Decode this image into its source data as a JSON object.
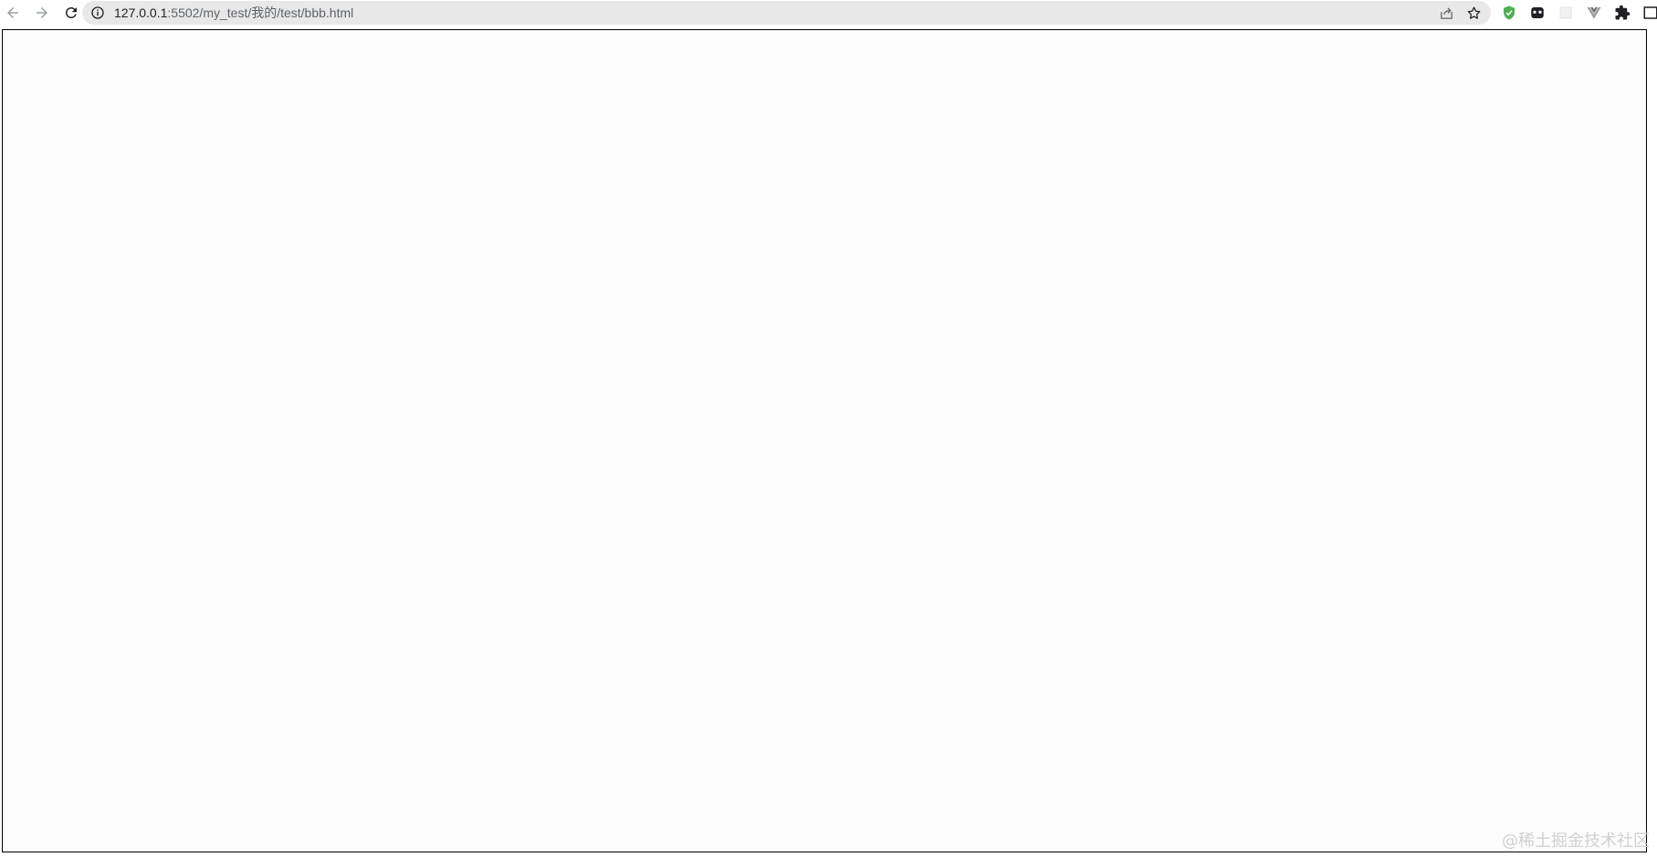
{
  "browser": {
    "url_host": "127.0.0.1",
    "url_path": ":5502/my_test/我的/test/bbb.html",
    "icons": {
      "back": "arrow-left-icon",
      "forward": "arrow-right-icon",
      "reload": "reload-icon",
      "site_info": "info-icon",
      "share": "share-icon",
      "bookmark": "star-icon"
    },
    "extensions": [
      "shield-check-icon",
      "ghost-icon",
      "blank-extension-icon",
      "vue-icon",
      "puzzle-icon"
    ]
  },
  "page": {
    "watermark": "@稀土掘金技术社区"
  },
  "colors": {
    "shield": "#4caf50",
    "frame_border": "#000000",
    "page_bg": "#fcfcfc",
    "omnibox_bg": "#e8e8e8"
  }
}
